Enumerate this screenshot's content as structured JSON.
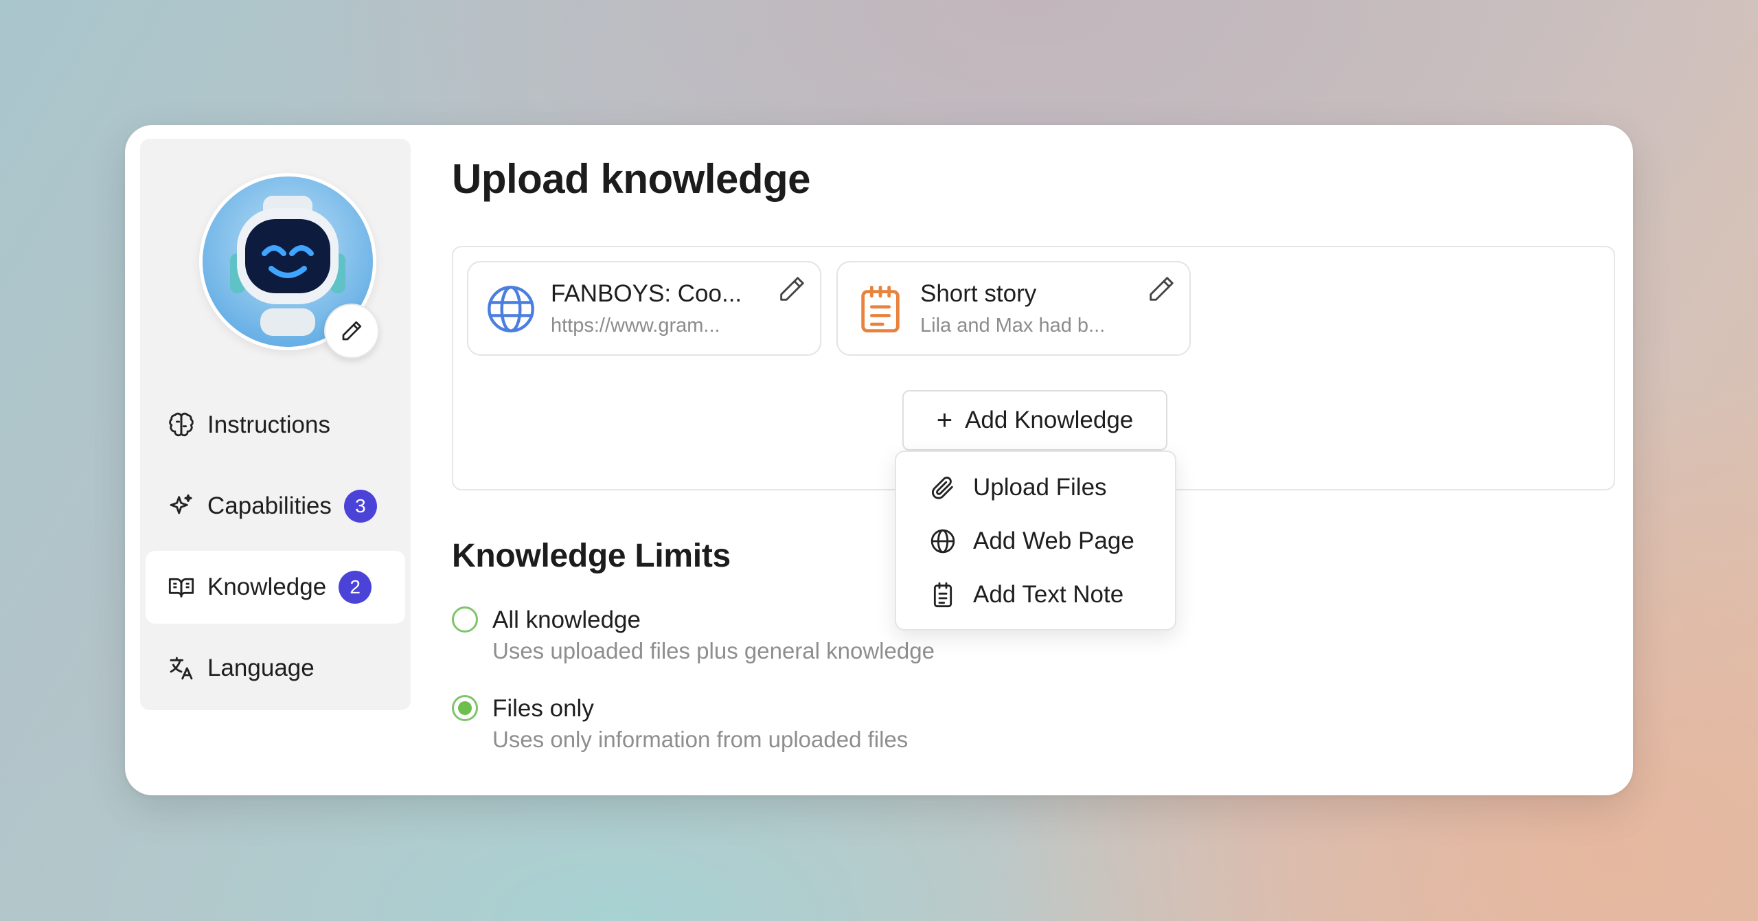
{
  "sidebar": {
    "items": [
      {
        "label": "Instructions",
        "icon": "brain-icon"
      },
      {
        "label": "Capabilities",
        "icon": "sparkles-icon",
        "badge": "3"
      },
      {
        "label": "Knowledge",
        "icon": "book-open-icon",
        "badge": "2",
        "active": true
      },
      {
        "label": "Language",
        "icon": "translate-icon"
      }
    ]
  },
  "main": {
    "title": "Upload knowledge",
    "knowledge_items": [
      {
        "title": "FANBOYS: Coo...",
        "subtitle": "https://www.gram...",
        "icon": "globe-icon"
      },
      {
        "title": "Short story",
        "subtitle": "Lila and Max had b...",
        "icon": "notepad-icon"
      }
    ],
    "add_button": {
      "label": "Add Knowledge"
    },
    "add_menu": [
      {
        "label": "Upload Files",
        "icon": "paperclip-icon"
      },
      {
        "label": "Add Web Page",
        "icon": "globe-icon"
      },
      {
        "label": "Add Text Note",
        "icon": "clipboard-icon"
      }
    ],
    "limits": {
      "title": "Knowledge Limits",
      "options": [
        {
          "title": "All knowledge",
          "subtitle": "Uses uploaded files plus general knowledge",
          "selected": false
        },
        {
          "title": "Files only",
          "subtitle": "Uses only information from uploaded files",
          "selected": true
        }
      ]
    }
  },
  "colors": {
    "badge": "#4b43d8",
    "radio_accent": "#6cbf4d",
    "globe_blue": "#4a7fe0",
    "note_orange": "#e8823d"
  }
}
